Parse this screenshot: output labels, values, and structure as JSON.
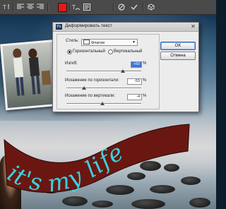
{
  "toolbar": {
    "icons": [
      "text-orientation-icon",
      "align-left-icon",
      "align-center-icon",
      "align-right-icon",
      "warp-text-icon",
      "character-panel-icon",
      "cancel-icon",
      "commit-icon",
      "3d-icon"
    ],
    "text_color": "#e21a1a"
  },
  "dialog": {
    "title": "Деформировать текст",
    "style_label": "Стиль:",
    "style_value": "Флагом",
    "horizontal_label": "Горизонтальный",
    "vertical_label": "Вертикальный",
    "bend_label": "Изгиб:",
    "bend_value": "+50",
    "bend_unit": "%",
    "hdist_label": "Искажение по горизонтали:",
    "hdist_value": "-53",
    "hdist_unit": "%",
    "vdist_label": "Искажение по вертикали:",
    "vdist_value": "-4",
    "vdist_unit": "%",
    "ok_label": "OK",
    "cancel_label": "Отмена",
    "bend_pos": 0.75,
    "hdist_pos": 0.235,
    "vdist_pos": 0.48
  },
  "canvas": {
    "warped_text": "it's my life",
    "text_color": "#39d2de",
    "flag_color": "#6a1712"
  }
}
